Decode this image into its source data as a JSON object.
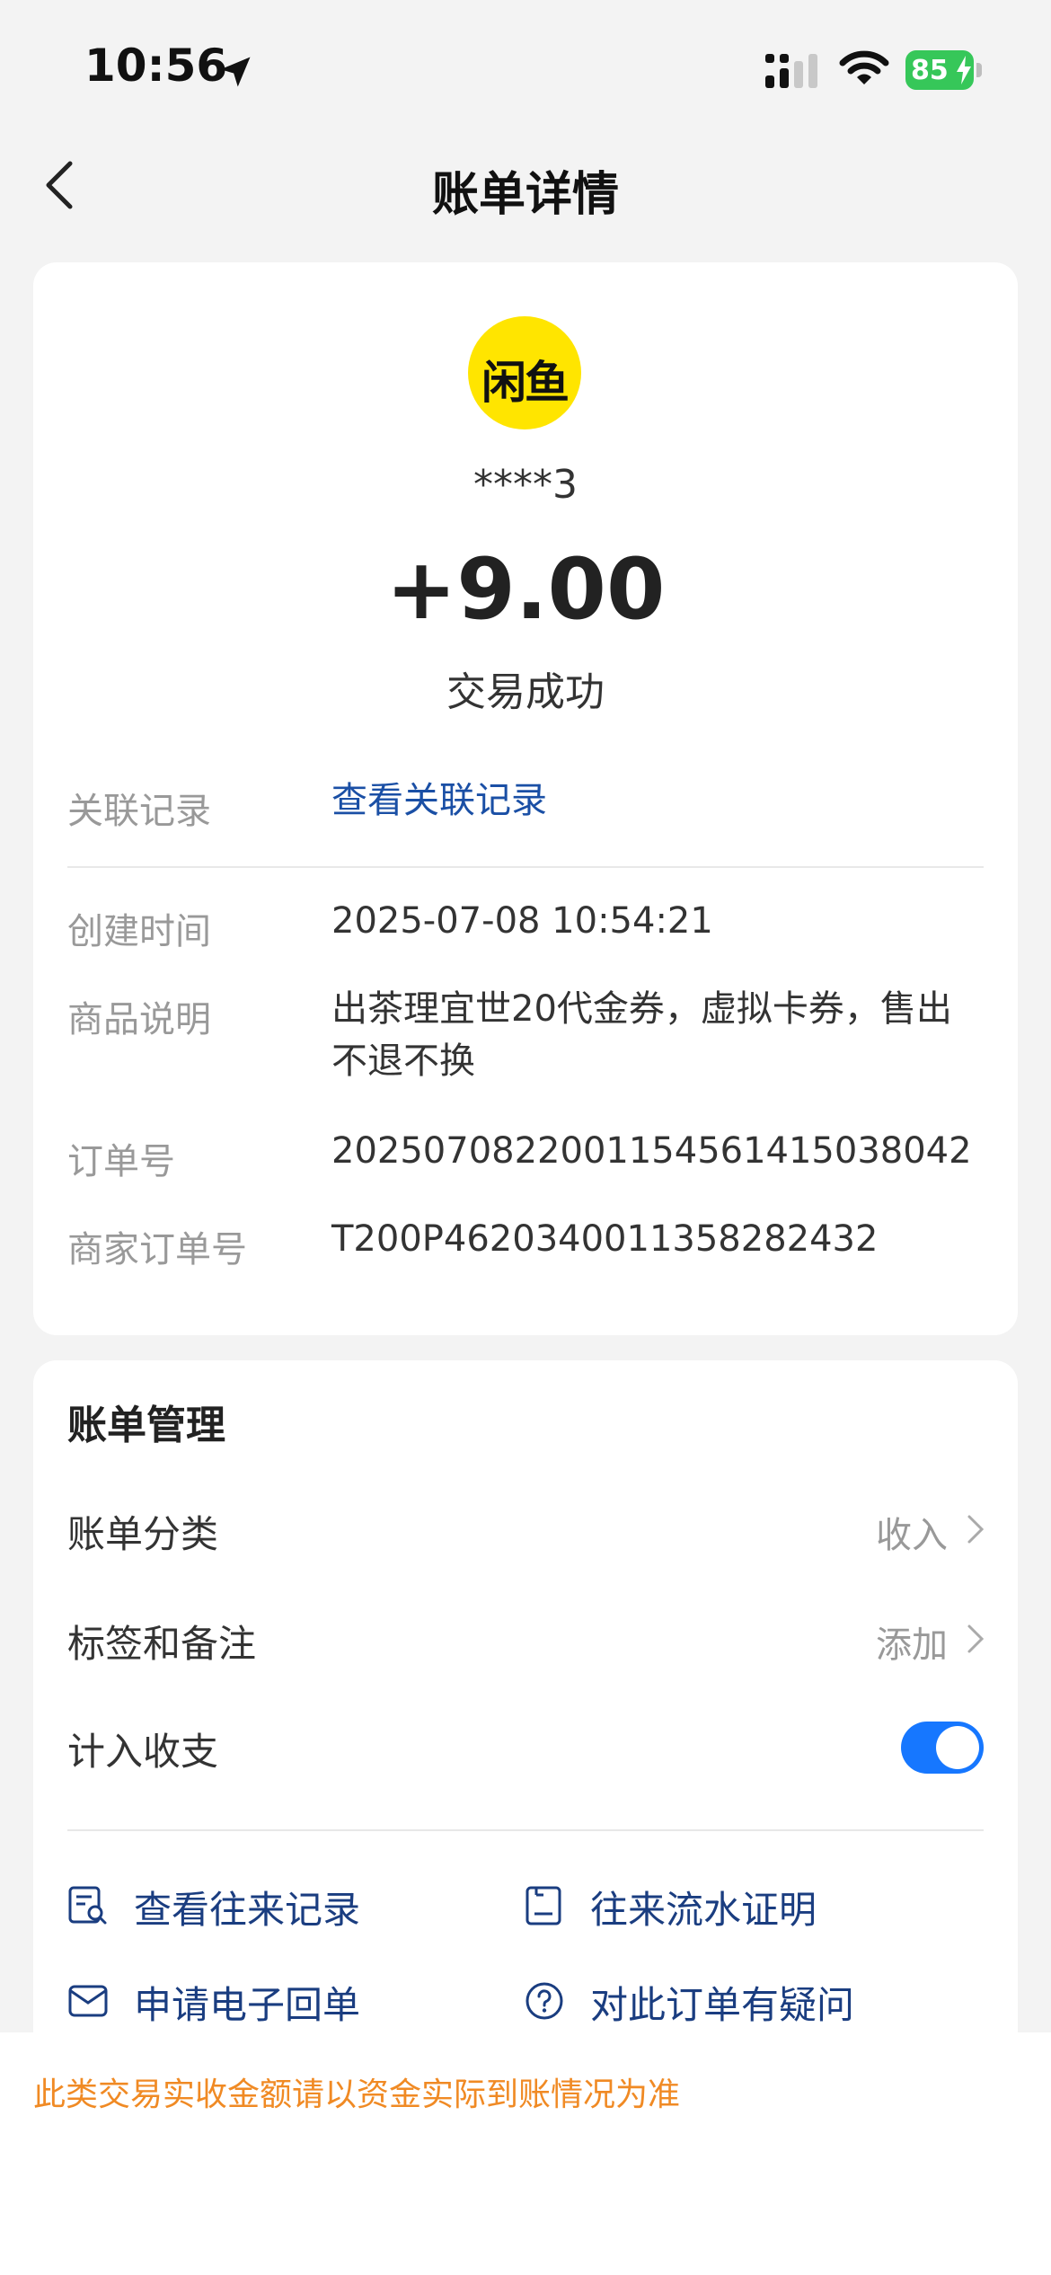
{
  "status_bar": {
    "time": "10:56",
    "battery": "85",
    "icons": [
      "location-arrow-icon",
      "signal-icon",
      "wifi-icon",
      "battery-charging-icon"
    ]
  },
  "nav": {
    "title": "账单详情",
    "back_icon": "chevron-left-icon"
  },
  "transaction": {
    "logo_text": "闲鱼",
    "logo_color": "#ffe500",
    "account": "****3",
    "amount": "+9.00",
    "status": "交易成功"
  },
  "details": {
    "related_label": "关联记录",
    "related_link": "查看关联记录",
    "created_label": "创建时间",
    "created_value": "2025-07-08 10:54:21",
    "desc_label": "商品说明",
    "desc_line1": "出茶理宜世20代金券，虚拟卡券，售出",
    "desc_line2": "不退不换",
    "order_label": "订单号",
    "order_value": "2025070822001154561415038042",
    "merchant_order_label": "商家订单号",
    "merchant_order_value": "T200P4620340011358282432"
  },
  "manage": {
    "title": "账单管理",
    "category_label": "账单分类",
    "category_value": "收入",
    "tags_label": "标签和备注",
    "tags_value": "添加",
    "include_label": "计入收支",
    "include_on": true,
    "actions": [
      {
        "label": "查看往来记录",
        "icon": "records-search-icon"
      },
      {
        "label": "往来流水证明",
        "icon": "certificate-icon"
      },
      {
        "label": "申请电子回单",
        "icon": "mail-icon"
      },
      {
        "label": "对此订单有疑问",
        "icon": "question-icon"
      }
    ]
  },
  "notice": "此类交易实收金额请以资金实际到账情况为准",
  "colors": {
    "accent": "#1677ff",
    "link": "#1a4fa5",
    "notice": "#f08a24",
    "background": "#f3f3f3"
  }
}
